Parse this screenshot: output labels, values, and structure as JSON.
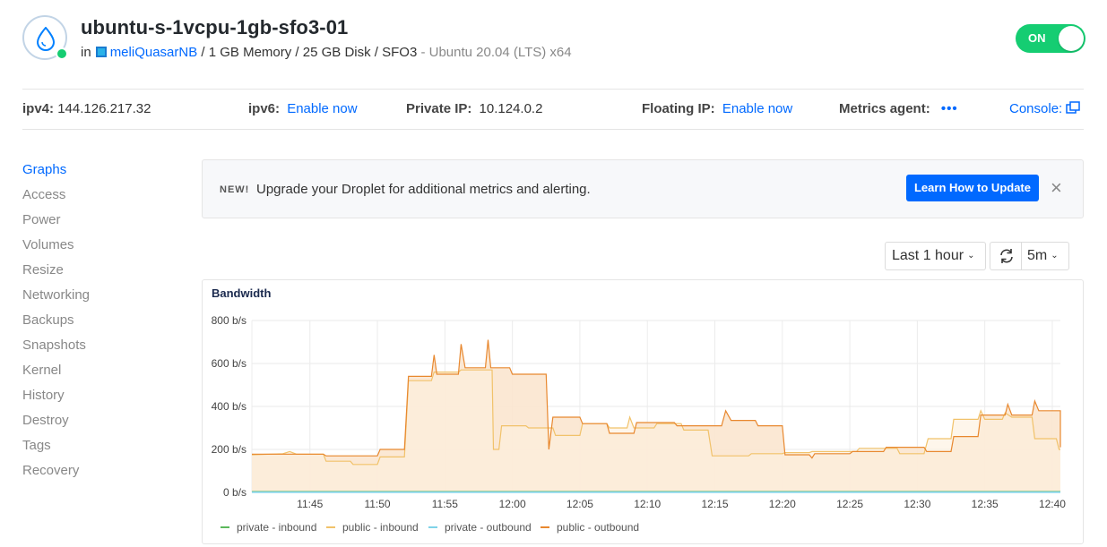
{
  "droplet": {
    "name": "ubuntu-s-1vcpu-1gb-sfo3-01",
    "in_label": "in",
    "project": "meliQuasarNB",
    "specs": "/ 1 GB Memory / 25 GB Disk / SFO3",
    "os": "- Ubuntu 20.04 (LTS) x64",
    "power_label": "ON",
    "status_color": "#15cd72"
  },
  "info": {
    "ipv4_key": "ipv4:",
    "ipv4_value": "144.126.217.32",
    "ipv6_key": "ipv6:",
    "ipv6_link": "Enable now",
    "private_key": "Private IP:",
    "private_value": "10.124.0.2",
    "floating_key": "Floating IP:",
    "floating_link": "Enable now",
    "metrics_key": "Metrics agent:",
    "metrics_value": "•••",
    "console_label": "Console:"
  },
  "sidebar": {
    "items": [
      {
        "label": "Graphs",
        "active": true
      },
      {
        "label": "Access"
      },
      {
        "label": "Power"
      },
      {
        "label": "Volumes"
      },
      {
        "label": "Resize"
      },
      {
        "label": "Networking"
      },
      {
        "label": "Backups"
      },
      {
        "label": "Snapshots"
      },
      {
        "label": "Kernel"
      },
      {
        "label": "History"
      },
      {
        "label": "Destroy"
      },
      {
        "label": "Tags"
      },
      {
        "label": "Recovery"
      }
    ]
  },
  "banner": {
    "badge": "NEW!",
    "message": "Upgrade your Droplet for additional metrics and alerting.",
    "button": "Learn How to Update",
    "close": "×"
  },
  "controls": {
    "range": "Last 1 hour",
    "interval": "5m"
  },
  "colors": {
    "accent": "#0069ff",
    "public_outbound": "#e8882f",
    "public_inbound": "#f1c26a",
    "private_inbound": "#5cb85c",
    "private_outbound": "#7fd3e8",
    "area_fill": "#fbe6cf"
  },
  "chart_data": {
    "type": "line",
    "title": "Bandwidth",
    "y_tick_labels": [
      "0 b/s",
      "200 b/s",
      "400 b/s",
      "600 b/s",
      "800 b/s"
    ],
    "ylim": [
      0,
      800
    ],
    "x_tick_labels": [
      "11:45",
      "11:50",
      "11:55",
      "12:00",
      "12:05",
      "12:10",
      "12:15",
      "12:20",
      "12:25",
      "12:30",
      "12:35",
      "12:40"
    ],
    "x_range_minutes": [
      -4.3,
      55.6
    ],
    "grid": true,
    "legend_position": "bottom-left",
    "series": [
      {
        "name": "private - inbound",
        "color": "#5cb85c",
        "points": [
          [
            -4.3,
            3
          ],
          [
            55.6,
            3
          ]
        ]
      },
      {
        "name": "public - inbound",
        "color": "#f1c26a",
        "points": [
          [
            -4.3,
            175
          ],
          [
            -2,
            180
          ],
          [
            -1.5,
            190
          ],
          [
            -1,
            178
          ],
          [
            1,
            178
          ],
          [
            1.2,
            145
          ],
          [
            3,
            145
          ],
          [
            3.2,
            130
          ],
          [
            5,
            130
          ],
          [
            5.2,
            165
          ],
          [
            7,
            165
          ],
          [
            7.3,
            520
          ],
          [
            9,
            520
          ],
          [
            9.2,
            560
          ],
          [
            11,
            560
          ],
          [
            11.2,
            570
          ],
          [
            13.5,
            570
          ],
          [
            13.6,
            200
          ],
          [
            14,
            200
          ],
          [
            14.2,
            310
          ],
          [
            16,
            310
          ],
          [
            16.2,
            300
          ],
          [
            18,
            300
          ],
          [
            18.2,
            265
          ],
          [
            20,
            265
          ],
          [
            20.2,
            320
          ],
          [
            22,
            320
          ],
          [
            22.2,
            300
          ],
          [
            23.5,
            300
          ],
          [
            23.7,
            350
          ],
          [
            24,
            300
          ],
          [
            25.5,
            300
          ],
          [
            25.7,
            320
          ],
          [
            27.5,
            320
          ],
          [
            27.7,
            290
          ],
          [
            29.5,
            290
          ],
          [
            29.8,
            170
          ],
          [
            32.5,
            170
          ],
          [
            32.7,
            180
          ],
          [
            35,
            180
          ],
          [
            35.2,
            185
          ],
          [
            37,
            185
          ],
          [
            37.2,
            190
          ],
          [
            40.5,
            190
          ],
          [
            40.7,
            205
          ],
          [
            43.5,
            205
          ],
          [
            43.7,
            180
          ],
          [
            45.5,
            180
          ],
          [
            45.8,
            250
          ],
          [
            47.5,
            250
          ],
          [
            47.7,
            340
          ],
          [
            49.5,
            340
          ],
          [
            49.7,
            380
          ],
          [
            50,
            340
          ],
          [
            51.3,
            340
          ],
          [
            51.5,
            370
          ],
          [
            52,
            350
          ],
          [
            53.5,
            350
          ],
          [
            53.7,
            250
          ],
          [
            55.3,
            250
          ],
          [
            55.5,
            200
          ],
          [
            55.6,
            200
          ]
        ]
      },
      {
        "name": "private - outbound",
        "color": "#7fd3e8",
        "points": [
          [
            -4.3,
            1
          ],
          [
            55.6,
            1
          ]
        ]
      },
      {
        "name": "public - outbound",
        "color": "#e8882f",
        "points": [
          [
            -4.3,
            178
          ],
          [
            1,
            178
          ],
          [
            1.2,
            170
          ],
          [
            5,
            170
          ],
          [
            5.2,
            200
          ],
          [
            7,
            200
          ],
          [
            7.3,
            540
          ],
          [
            9,
            540
          ],
          [
            9.2,
            640
          ],
          [
            9.4,
            550
          ],
          [
            11,
            550
          ],
          [
            11.2,
            690
          ],
          [
            11.5,
            580
          ],
          [
            13,
            580
          ],
          [
            13.2,
            710
          ],
          [
            13.4,
            580
          ],
          [
            14.8,
            580
          ],
          [
            15,
            550
          ],
          [
            17.5,
            550
          ],
          [
            17.7,
            200
          ],
          [
            18,
            350
          ],
          [
            20,
            350
          ],
          [
            20.2,
            320
          ],
          [
            22,
            320
          ],
          [
            22.2,
            275
          ],
          [
            24,
            275
          ],
          [
            24.2,
            325
          ],
          [
            27,
            325
          ],
          [
            27.2,
            310
          ],
          [
            29,
            310
          ],
          [
            29.2,
            310
          ],
          [
            30.5,
            310
          ],
          [
            30.8,
            380
          ],
          [
            31.2,
            335
          ],
          [
            33,
            335
          ],
          [
            33.2,
            310
          ],
          [
            35,
            310
          ],
          [
            35.2,
            175
          ],
          [
            37,
            175
          ],
          [
            37.2,
            160
          ],
          [
            37.4,
            180
          ],
          [
            40,
            180
          ],
          [
            40.2,
            190
          ],
          [
            42.5,
            190
          ],
          [
            42.7,
            210
          ],
          [
            45.5,
            210
          ],
          [
            45.7,
            190
          ],
          [
            47.5,
            190
          ],
          [
            47.7,
            260
          ],
          [
            49.5,
            260
          ],
          [
            49.7,
            360
          ],
          [
            51.5,
            360
          ],
          [
            51.7,
            410
          ],
          [
            52,
            360
          ],
          [
            53.5,
            360
          ],
          [
            53.7,
            425
          ],
          [
            54,
            380
          ],
          [
            56.8,
            380
          ],
          [
            57,
            300
          ],
          [
            59,
            300
          ],
          [
            59.2,
            210
          ],
          [
            55.6,
            210
          ]
        ]
      }
    ]
  }
}
